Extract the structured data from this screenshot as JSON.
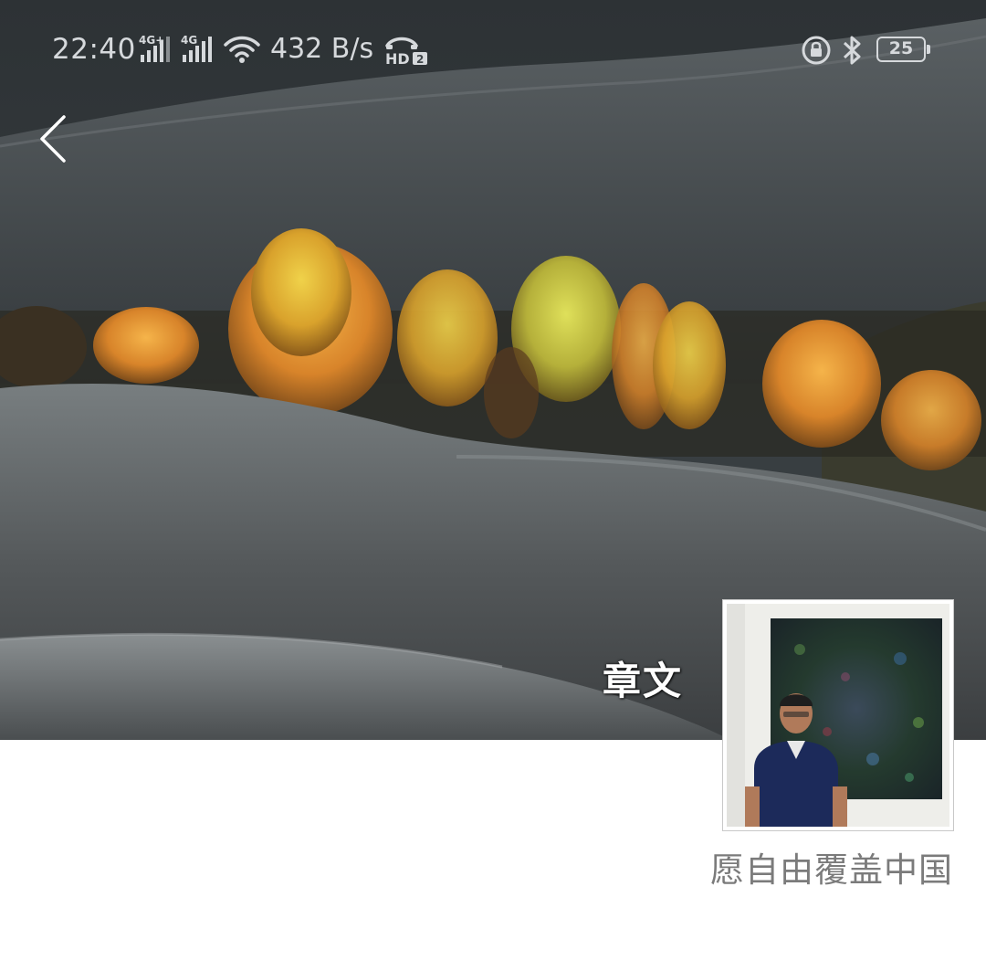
{
  "status_bar": {
    "time": "22:40",
    "signal_1_label": "4G+",
    "signal_2_label": "4G",
    "network_speed": "432 B/s",
    "hd_label": "HD",
    "hd_sub": "2",
    "battery_level": "25",
    "icons": [
      "signal-icon",
      "signal-icon",
      "wifi-icon",
      "hd-call-icon",
      "rotation-lock-icon",
      "bluetooth-icon",
      "battery-icon"
    ]
  },
  "navigation": {
    "back_icon": "chevron-left-icon"
  },
  "profile": {
    "author_name": "章文",
    "motto": "愿自由覆盖中国"
  },
  "colors": {
    "hills": "#44494c",
    "foliage": "#d99a2a",
    "text_gray": "#7b7b7b"
  }
}
